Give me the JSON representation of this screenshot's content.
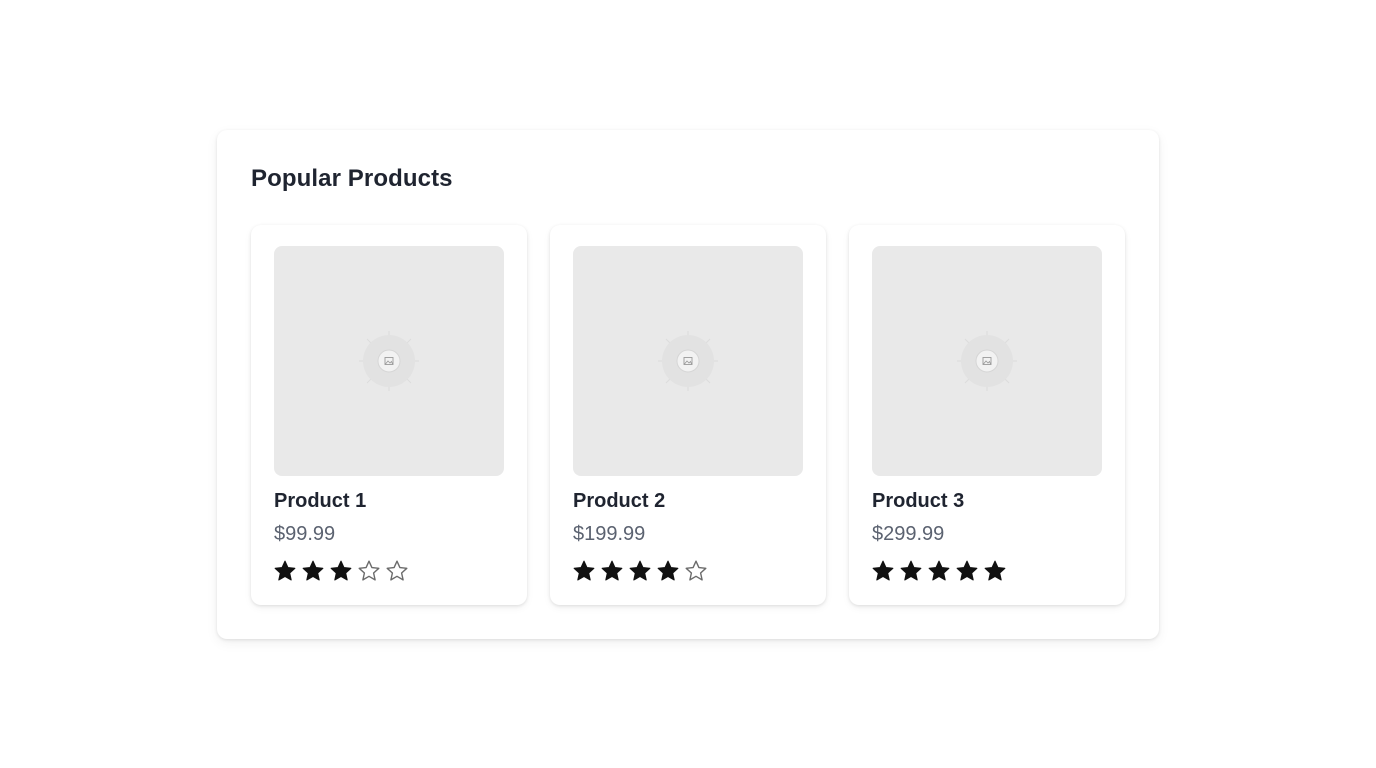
{
  "section": {
    "title": "Popular Products"
  },
  "products": [
    {
      "name": "Product 1",
      "price": "$99.99",
      "rating": 3,
      "max_rating": 5,
      "image_icon": "image-placeholder-icon"
    },
    {
      "name": "Product 2",
      "price": "$199.99",
      "rating": 4,
      "max_rating": 5,
      "image_icon": "image-placeholder-icon"
    },
    {
      "name": "Product 3",
      "price": "$299.99",
      "rating": 5,
      "max_rating": 5,
      "image_icon": "image-placeholder-icon"
    }
  ],
  "colors": {
    "star_filled": "#111111",
    "star_empty": "#6b6b6b",
    "title_text": "#1f2430",
    "price_text": "#5b6270",
    "image_bg": "#e9e9e9"
  }
}
